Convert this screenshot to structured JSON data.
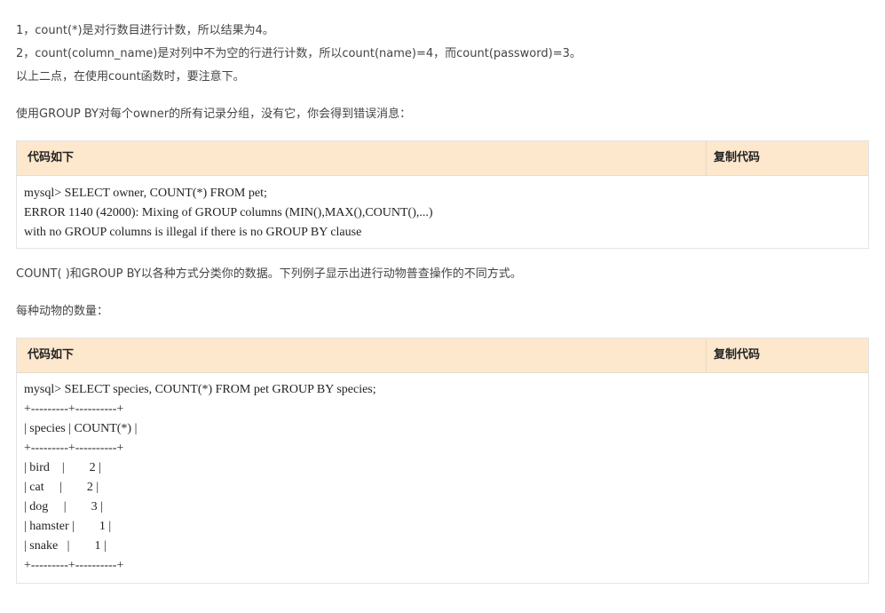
{
  "intro": {
    "line1": "1，count(*)是对行数目进行计数，所以结果为4。",
    "line2": "2，count(column_name)是对列中不为空的行进行计数，所以count(name)=4，而count(password)=3。",
    "line3": "以上二点，在使用count函数时，要注意下。"
  },
  "para_groupby": "使用GROUP BY对每个owner的所有记录分组，没有它，你会得到错误消息：",
  "code1": {
    "title": "代码如下",
    "copy_label": "复制代码",
    "lines": [
      "mysql> SELECT owner, COUNT(*) FROM pet;",
      "ERROR 1140 (42000): Mixing of GROUP columns (MIN(),MAX(),COUNT(),...)",
      "with no GROUP columns is illegal if there is no GROUP BY clause"
    ]
  },
  "para_count": "COUNT( )和GROUP BY以各种方式分类你的数据。下列例子显示出进行动物普查操作的不同方式。",
  "para_each": "每种动物的数量：",
  "code2": {
    "title": "代码如下",
    "copy_label": "复制代码",
    "lines": [
      "mysql> SELECT species, COUNT(*) FROM pet GROUP BY species;",
      "+---------+----------+",
      "| species | COUNT(*) |",
      "+---------+----------+",
      "| bird    |        2 |",
      "| cat     |        2 |",
      "| dog     |        3 |",
      "| hamster |        1 |",
      "| snake   |        1 |",
      "+---------+----------+"
    ]
  }
}
